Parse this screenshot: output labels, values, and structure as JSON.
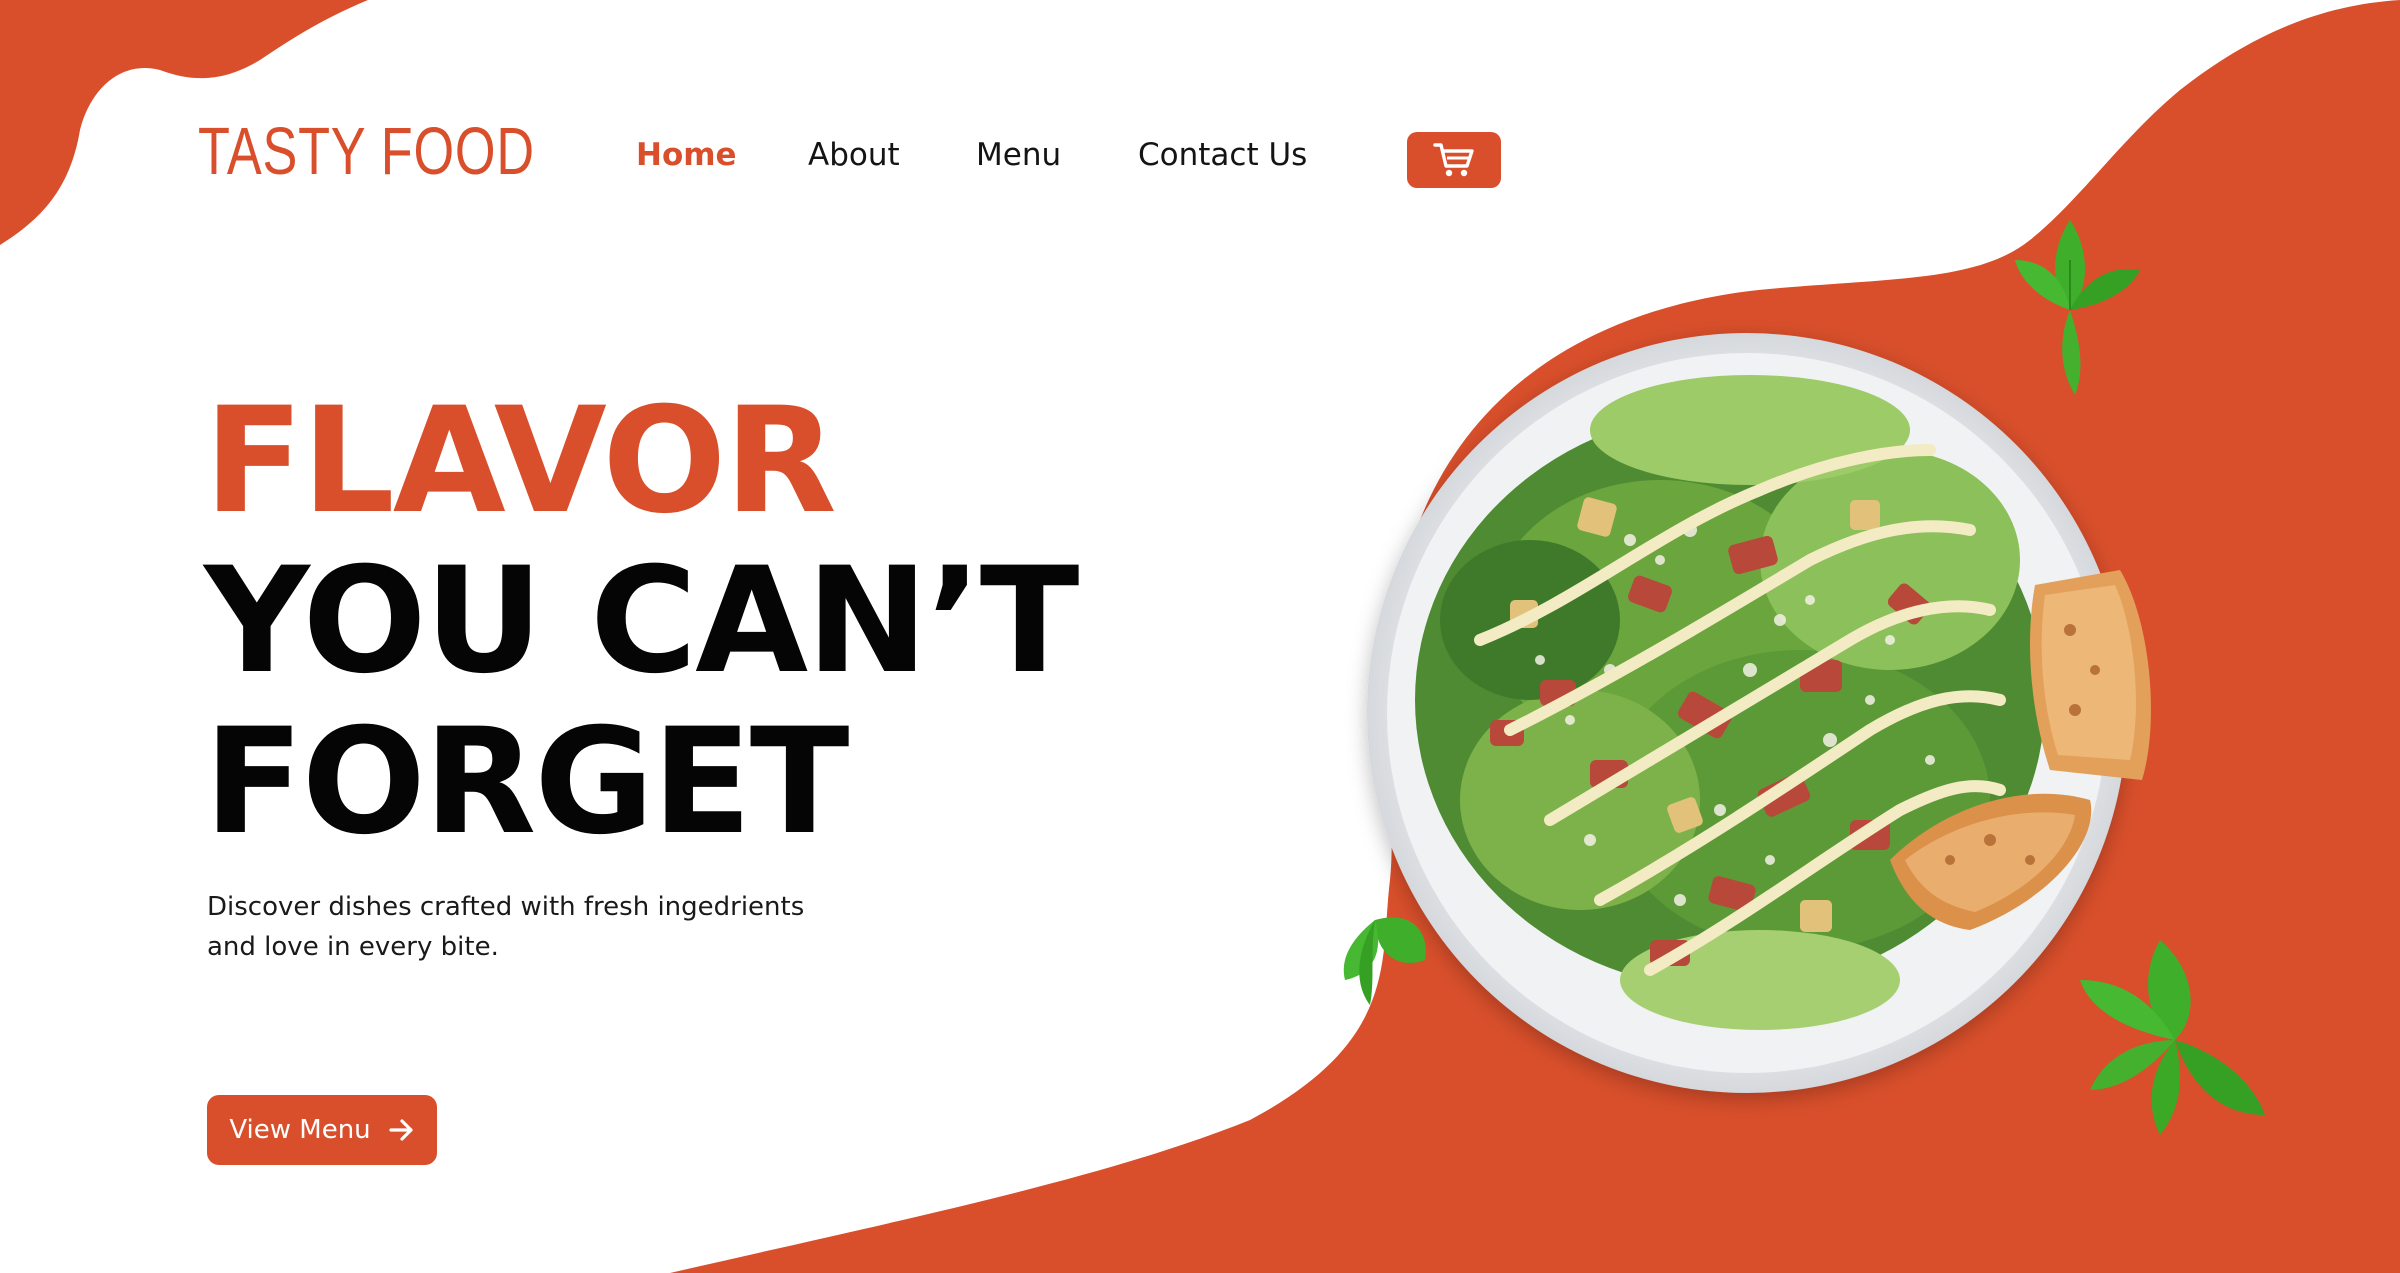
{
  "brand": {
    "logo_text": "TASTY FOOD"
  },
  "nav": {
    "items": [
      {
        "label": "Home",
        "active": true
      },
      {
        "label": "About",
        "active": false
      },
      {
        "label": "Menu",
        "active": false
      },
      {
        "label": "Contact Us",
        "active": false
      }
    ]
  },
  "cart": {
    "icon": "shopping-cart-icon"
  },
  "hero": {
    "headline_line1": "FLAVOR",
    "headline_line2": "YOU CAN’T",
    "headline_line3": "FORGET",
    "subtext_line1": "Discover dishes crafted with fresh ingedrients",
    "subtext_line2": "and love in every bite.",
    "cta_label": "View Menu",
    "cta_icon": "arrow-right-icon"
  },
  "image": {
    "subject": "salad-plate-image"
  },
  "colors": {
    "accent": "#D94F2B",
    "text_dark": "#050505",
    "plate": "#E9EBEE",
    "leaf_green": "#3FAE2A",
    "dressing": "#F3EBC3",
    "bread": "#E3A05A",
    "bacon": "#B8483A"
  }
}
